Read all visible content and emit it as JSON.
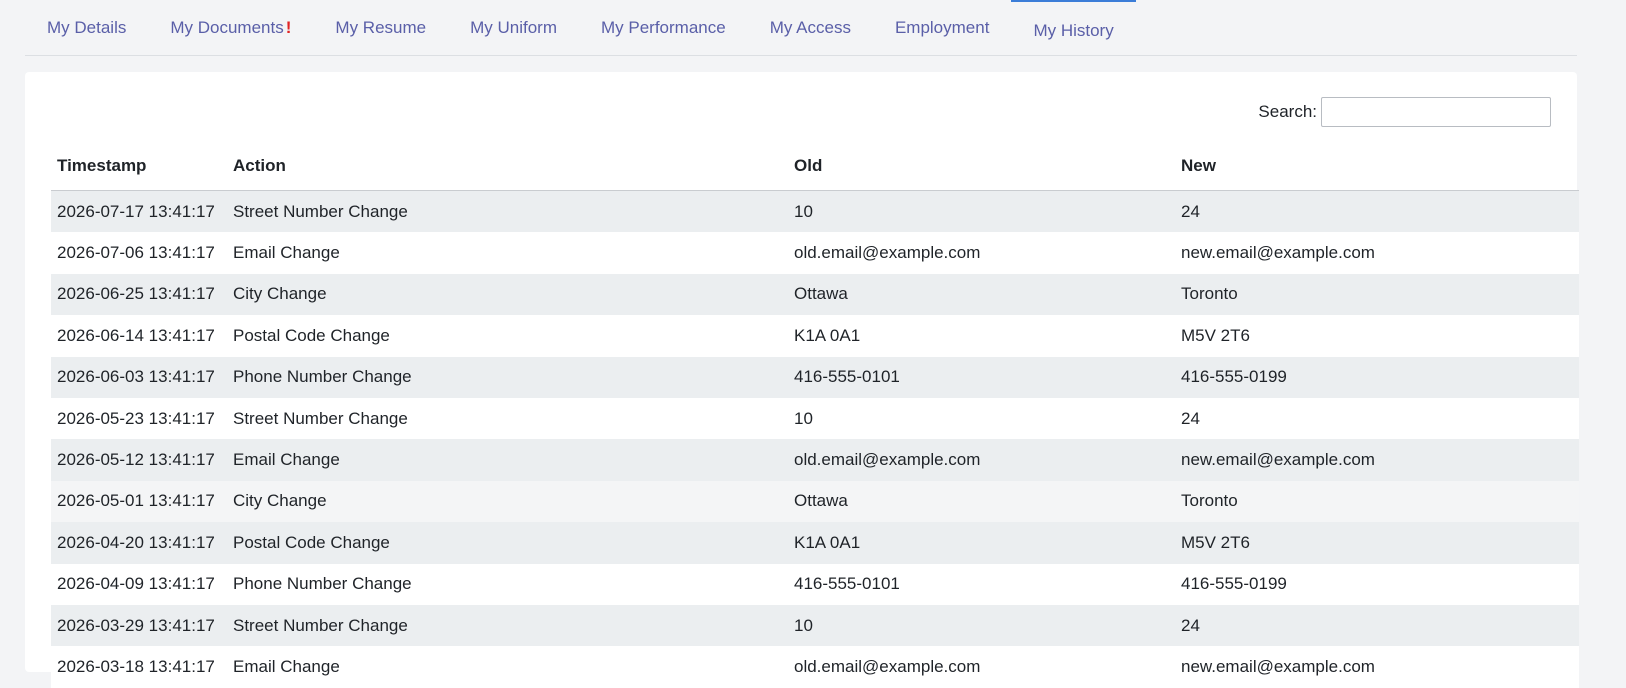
{
  "tabs": [
    {
      "label": "My Documents",
      "alert": "!"
    },
    {
      "label": "My Resume"
    },
    {
      "label": "My Uniform"
    },
    {
      "label": "My Performance"
    },
    {
      "label": "My Access"
    },
    {
      "label": "Employment"
    },
    {
      "label": "My History",
      "active": true
    }
  ],
  "first_tab": "My Details",
  "search": {
    "label": "Search:",
    "value": ""
  },
  "table": {
    "headers": [
      "Timestamp",
      "Action",
      "Old",
      "New"
    ],
    "rows": [
      [
        "2026-07-17 13:41:17",
        "Street Number Change",
        "10",
        "24"
      ],
      [
        "2026-07-06 13:41:17",
        "Email Change",
        "old.email@example.com",
        "new.email@example.com"
      ],
      [
        "2026-06-25 13:41:17",
        "City Change",
        "Ottawa",
        "Toronto"
      ],
      [
        "2026-06-14 13:41:17",
        "Postal Code Change",
        "K1A 0A1",
        "M5V 2T6"
      ],
      [
        "2026-06-03 13:41:17",
        "Phone Number Change",
        "416-555-0101",
        "416-555-0199"
      ],
      [
        "2026-05-23 13:41:17",
        "Street Number Change",
        "10",
        "24"
      ],
      [
        "2026-05-12 13:41:17",
        "Email Change",
        "old.email@example.com",
        "new.email@example.com"
      ],
      [
        "2026-05-01 13:41:17",
        "City Change",
        "Ottawa",
        "Toronto"
      ],
      [
        "2026-04-20 13:41:17",
        "Postal Code Change",
        "K1A 0A1",
        "M5V 2T6"
      ],
      [
        "2026-04-09 13:41:17",
        "Phone Number Change",
        "416-555-0101",
        "416-555-0199"
      ],
      [
        "2026-03-29 13:41:17",
        "Street Number Change",
        "10",
        "24"
      ],
      [
        "2026-03-18 13:41:17",
        "Email Change",
        "old.email@example.com",
        "new.email@example.com"
      ]
    ]
  }
}
